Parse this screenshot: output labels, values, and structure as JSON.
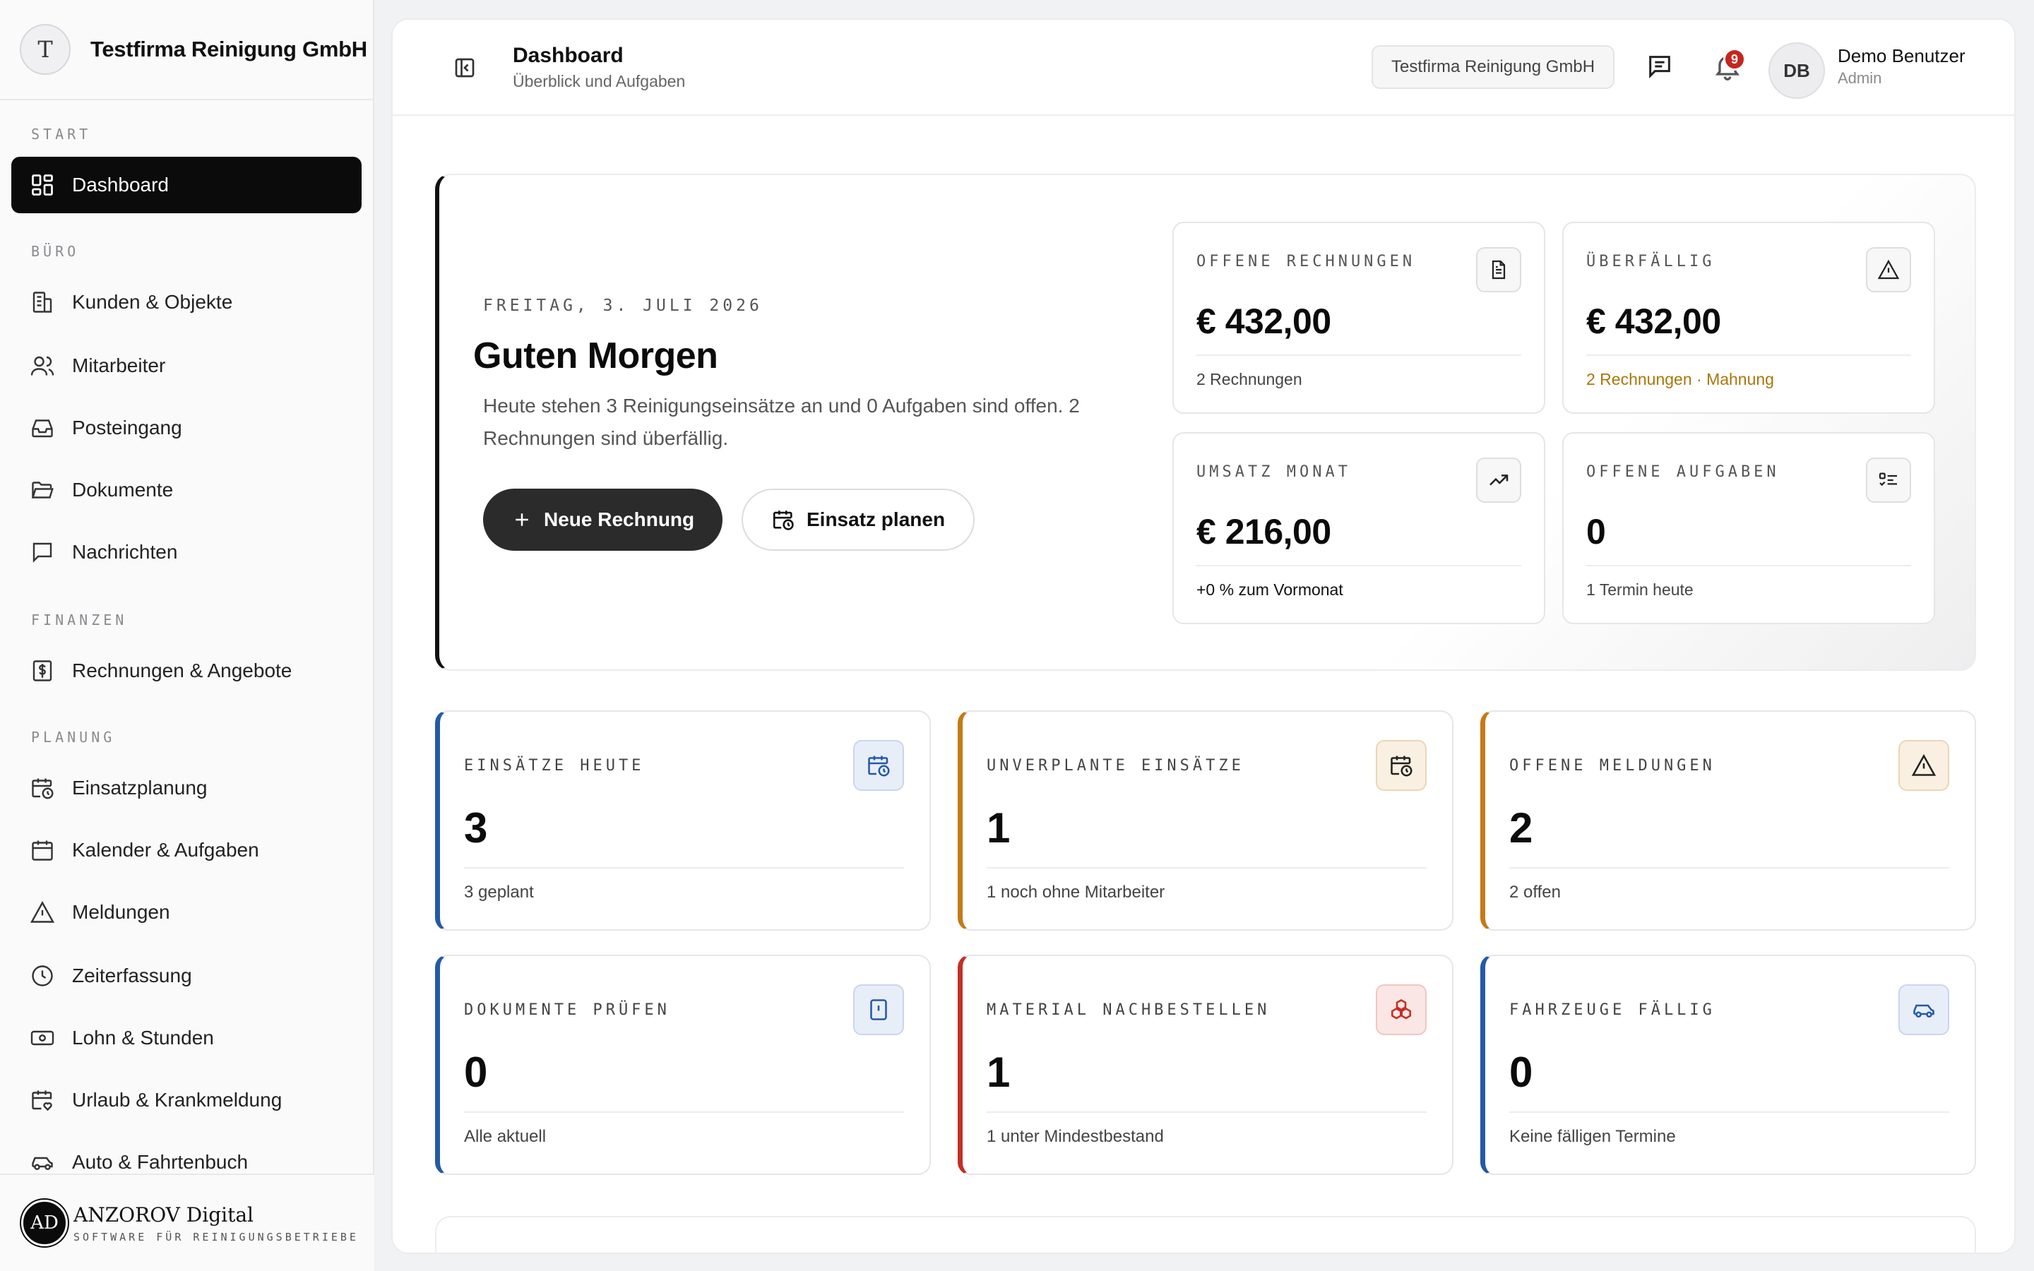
{
  "brand": {
    "initial": "T",
    "name": "Testfirma Reinigung GmbH"
  },
  "sidebar": {
    "sections": {
      "start": "START",
      "buero": "BÜRO",
      "finanzen": "FINANZEN",
      "planung": "PLANUNG"
    },
    "items": [
      {
        "label": "Dashboard",
        "icon": "dashboard-icon",
        "active": true
      },
      {
        "label": "Kunden & Objekte",
        "icon": "building-icon"
      },
      {
        "label": "Mitarbeiter",
        "icon": "users-icon"
      },
      {
        "label": "Posteingang",
        "icon": "inbox-icon"
      },
      {
        "label": "Dokumente",
        "icon": "folder-icon"
      },
      {
        "label": "Nachrichten",
        "icon": "message-icon"
      },
      {
        "label": "Rechnungen & Angebote",
        "icon": "invoice-dollar-icon"
      },
      {
        "label": "Einsatzplanung",
        "icon": "calendar-clock-icon"
      },
      {
        "label": "Kalender & Aufgaben",
        "icon": "calendar-icon"
      },
      {
        "label": "Meldungen",
        "icon": "warning-icon"
      },
      {
        "label": "Zeiterfassung",
        "icon": "clock-icon"
      },
      {
        "label": "Lohn & Stunden",
        "icon": "money-icon"
      },
      {
        "label": "Urlaub & Krankmeldung",
        "icon": "calendar-heart-icon"
      },
      {
        "label": "Auto & Fahrtenbuch",
        "icon": "car-icon"
      }
    ],
    "footer": {
      "logo": "AD",
      "title": "ANZOROV Digital",
      "subtitle": "SOFTWARE FÜR REINIGUNGSBETRIEBE"
    }
  },
  "topbar": {
    "title": "Dashboard",
    "subtitle": "Überblick und Aufgaben",
    "company": "Testfirma Reinigung GmbH",
    "notification_count": "9",
    "user_initials": "DB",
    "user_name": "Demo Benutzer",
    "user_role": "Admin"
  },
  "hero": {
    "date": "FREITAG, 3. JULI 2026",
    "greeting": "Guten Morgen",
    "text": "Heute stehen 3 Reinigungseinsätze an und 0 Aufgaben sind offen. 2 Rechnungen sind überfällig.",
    "primary_button": "Neue Rechnung",
    "secondary_button": "Einsatz planen"
  },
  "kpis": [
    {
      "label": "OFFENE RECHNUNGEN",
      "value": "€ 432,00",
      "note": "2 Rechnungen",
      "icon": "document-icon"
    },
    {
      "label": "ÜBERFÄLLIG",
      "value": "€ 432,00",
      "note": "2 Rechnungen · Mahnung",
      "icon": "warning-icon"
    },
    {
      "label": "UMSATZ MONAT",
      "value": "€ 216,00",
      "note": "+0 % zum Vormonat",
      "icon": "trend-up-icon"
    },
    {
      "label": "OFFENE AUFGABEN",
      "value": "0",
      "note": "1 Termin heute",
      "icon": "checklist-icon"
    }
  ],
  "stats": [
    {
      "label": "EINSÄTZE HEUTE",
      "value": "3",
      "note": "3 geplant",
      "accent": "#2459a8",
      "icon": "calendar-clock-icon"
    },
    {
      "label": "UNVERPLANTE EINSÄTZE",
      "value": "1",
      "note": "1 noch ohne Mitarbeiter",
      "accent": "#c57a16",
      "icon": "calendar-clock-icon"
    },
    {
      "label": "OFFENE MELDUNGEN",
      "value": "2",
      "note": "2 offen",
      "accent": "#c57a16",
      "icon": "warning-icon"
    },
    {
      "label": "DOKUMENTE PRÜFEN",
      "value": "0",
      "note": "Alle aktuell",
      "accent": "#2459a8",
      "icon": "document-alert-icon"
    },
    {
      "label": "MATERIAL NACHBESTELLEN",
      "value": "1",
      "note": "1 unter Mindestbestand",
      "accent": "#c42f25",
      "icon": "boxes-icon"
    },
    {
      "label": "FAHRZEUGE FÄLLIG",
      "value": "0",
      "note": "Keine fälligen Termine",
      "accent": "#2459a8",
      "icon": "car-icon"
    }
  ],
  "colors": {
    "active_nav": "#0b0b0c",
    "warn_text": "#a8770b",
    "badge": "#c4271f"
  }
}
